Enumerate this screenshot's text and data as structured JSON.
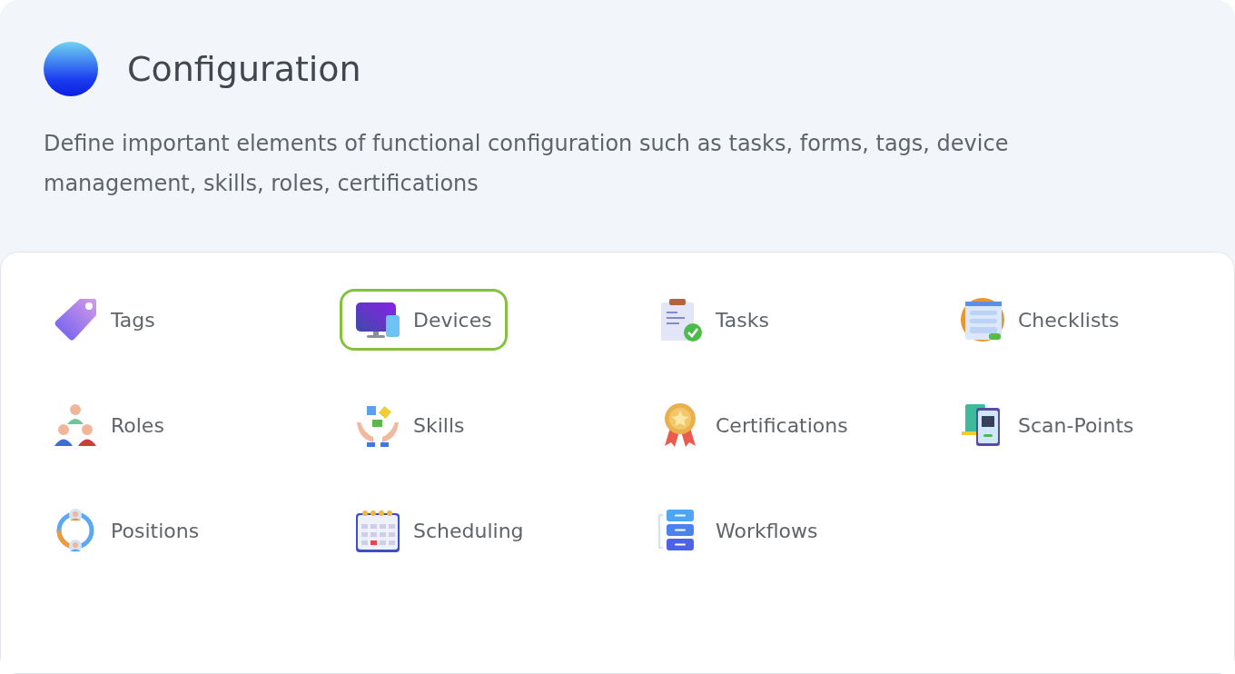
{
  "header": {
    "title": "Configuration",
    "description": "Define important elements of functional configuration such as tasks, forms, tags, device management, skills, roles, certifications"
  },
  "items": [
    {
      "label": "Tags",
      "kind": "tag",
      "selected": false
    },
    {
      "label": "Devices",
      "kind": "device",
      "selected": true
    },
    {
      "label": "Tasks",
      "kind": "task",
      "selected": false
    },
    {
      "label": "Checklists",
      "kind": "checklist",
      "selected": false
    },
    {
      "label": "Roles",
      "kind": "role",
      "selected": false
    },
    {
      "label": "Skills",
      "kind": "skill",
      "selected": false
    },
    {
      "label": "Certifications",
      "kind": "certification",
      "selected": false
    },
    {
      "label": "Scan-Points",
      "kind": "scan",
      "selected": false
    },
    {
      "label": "Positions",
      "kind": "position",
      "selected": false
    },
    {
      "label": "Scheduling",
      "kind": "schedule",
      "selected": false
    },
    {
      "label": "Workflows",
      "kind": "workflow",
      "selected": false
    }
  ]
}
